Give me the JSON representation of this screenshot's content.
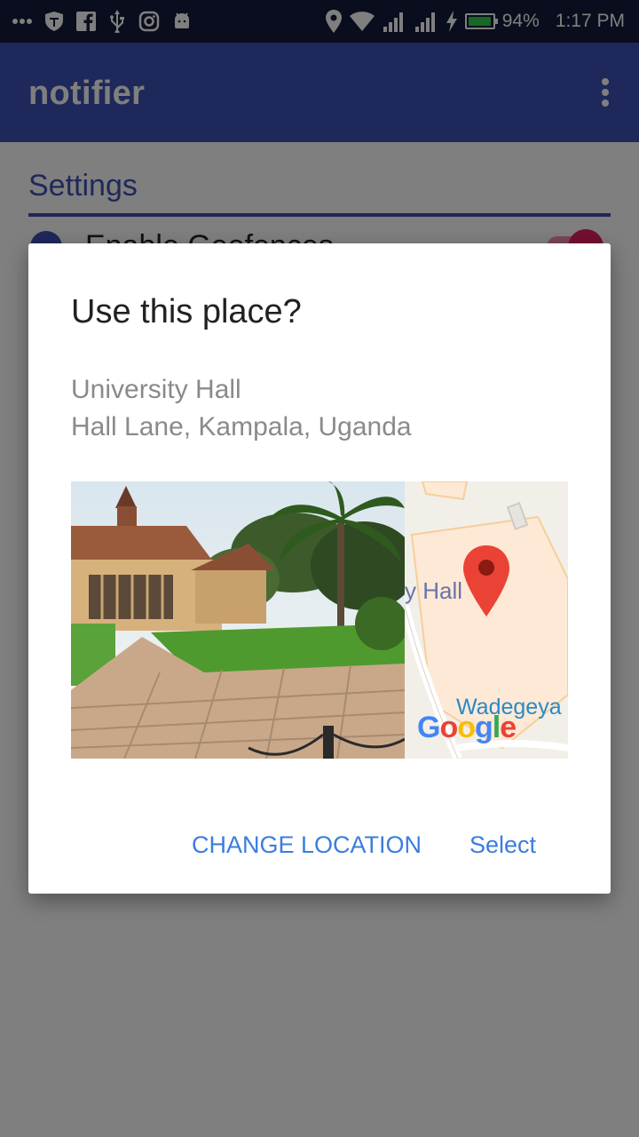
{
  "status_bar": {
    "battery_percent": "94%",
    "time": "1:17 PM",
    "battery_color": "#2ed14a",
    "icons_left": [
      "more-icon",
      "shield-icon",
      "facebook-icon",
      "usb-icon",
      "instagram-icon",
      "android-icon"
    ],
    "icons_right": [
      "location-icon",
      "wifi-icon",
      "signal-icon",
      "signal-icon",
      "charging-icon",
      "battery-icon"
    ]
  },
  "app_bar": {
    "title": "notifier",
    "color": "#3f51b5"
  },
  "settings": {
    "header": "Settings",
    "pref_label": "Enable Geofences",
    "switch_on": true
  },
  "dialog": {
    "title": "Use this place?",
    "place_name": "University Hall",
    "place_address": "Hall Lane, Kampala, Uganda",
    "map_labels": {
      "place": "y Hall",
      "area": "Wadegeya",
      "brand": "Google"
    },
    "buttons": {
      "change_location": "CHANGE LOCATION",
      "select": "Select"
    },
    "accent_color": "#3b7de0"
  }
}
